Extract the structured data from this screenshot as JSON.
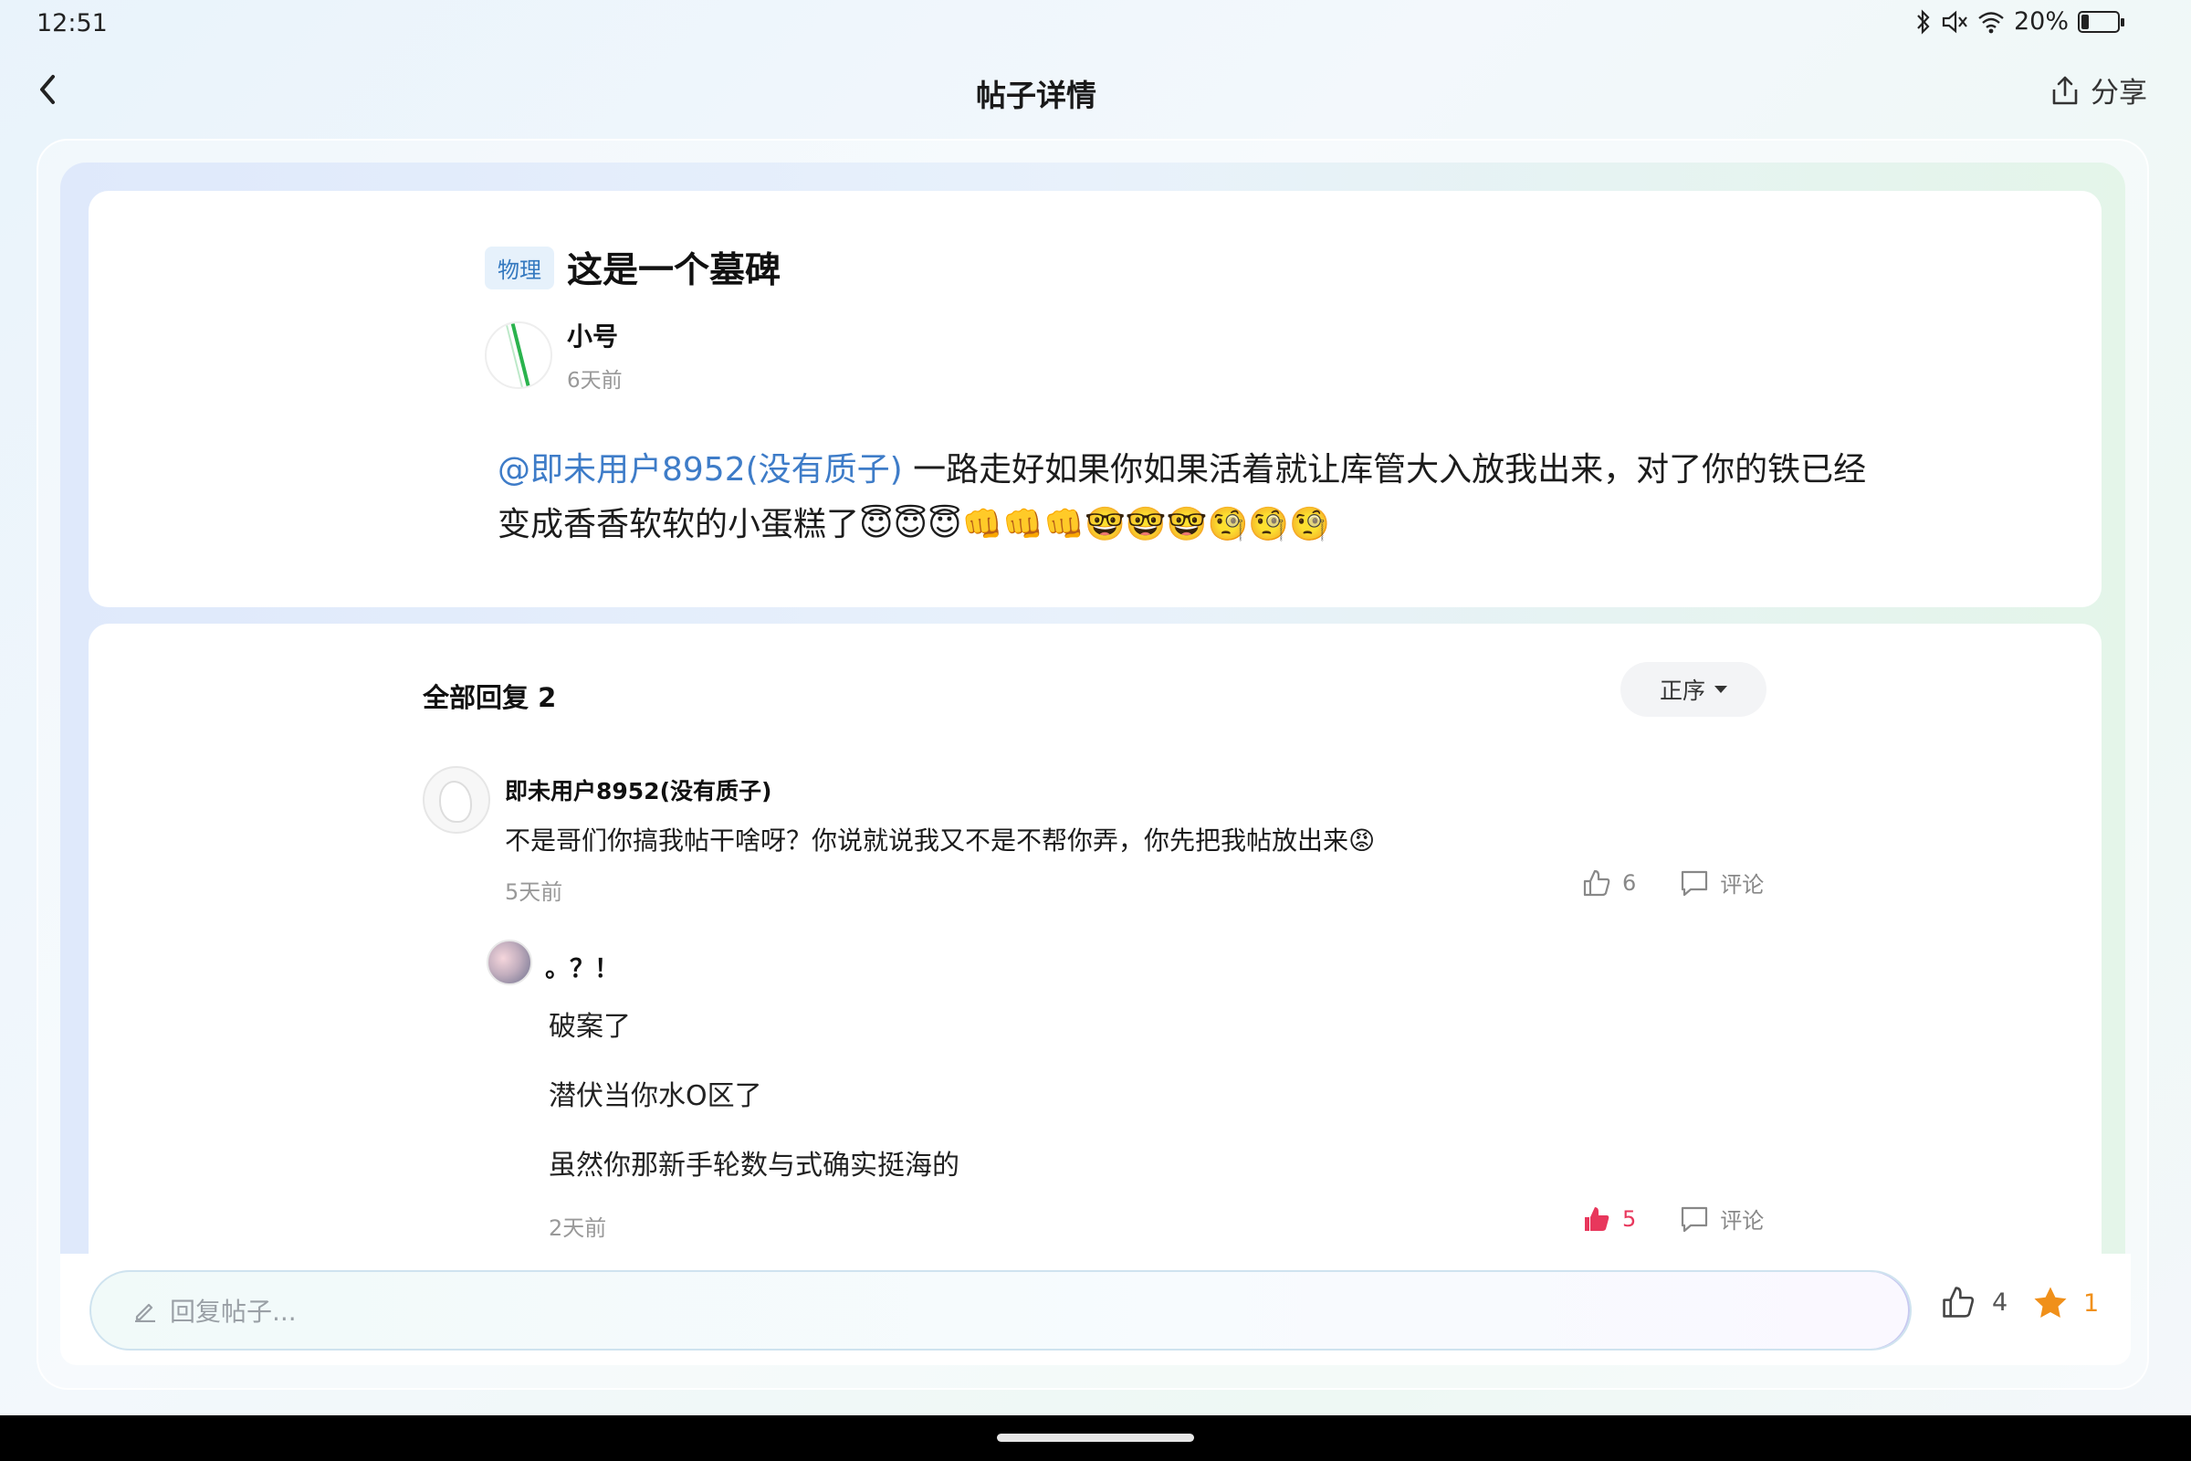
{
  "status_bar": {
    "time": "12:51",
    "battery": "20%",
    "battery_level": 0.2
  },
  "header": {
    "title": "帖子详情",
    "share_label": "分享"
  },
  "post": {
    "tag": "物理",
    "title": "这是一个墓碑",
    "author": "小号",
    "time": "6天前",
    "mention": "@即未用户8952(没有质子)",
    "body_line1": " 一路走好如果你如果活着就让库管大入放我出来，对了你的铁已经",
    "body_line2": "变成香香软软的小蛋糕了😇😇😇👊👊👊🤓🤓🤓🧐🧐🧐"
  },
  "comments": {
    "header": "全部回复 2",
    "sort_label": "正序",
    "items": [
      {
        "name": "即未用户8952(没有质子)",
        "text": "不是哥们你搞我帖干啥呀？你说就说我又不是不帮你弄，你先把我帖放出来😡",
        "time": "5天前",
        "likes": "6",
        "comment_label": "评论"
      }
    ],
    "reply": {
      "name": "。？！",
      "lines": [
        "破案了",
        "潜伏当你水O区了",
        "虽然你那新手轮数与式确实挺海的"
      ],
      "time": "2天前",
      "likes": "5",
      "comment_label": "评论"
    }
  },
  "reply_bar": {
    "placeholder": "回复帖子...",
    "likes": "4",
    "stars": "1"
  },
  "colors": {
    "accent_blue": "#3e7cc8",
    "like_red": "#e8375c",
    "star_orange": "#f0901a"
  }
}
